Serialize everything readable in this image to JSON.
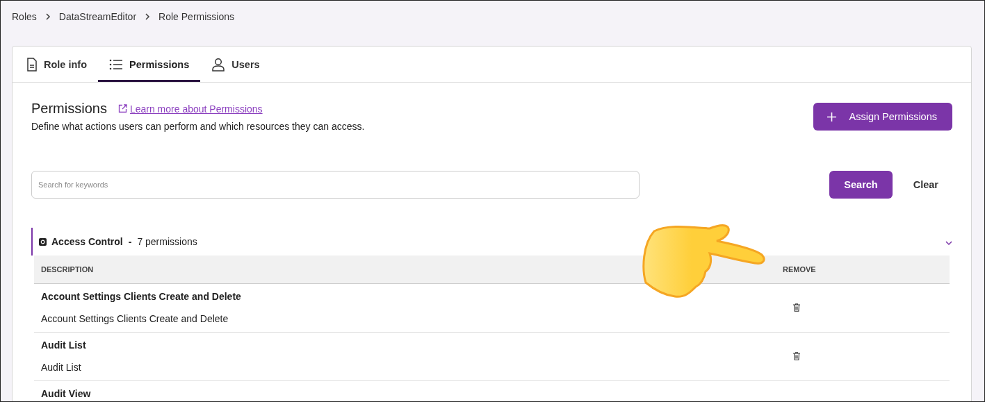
{
  "breadcrumb": [
    "Roles",
    "DataStreamEditor",
    "Role Permissions"
  ],
  "tabs": [
    {
      "label": "Role info",
      "selected": false
    },
    {
      "label": "Permissions",
      "selected": true
    },
    {
      "label": "Users",
      "selected": false
    }
  ],
  "header": {
    "title": "Permissions",
    "link": "Learn more about Permissions",
    "description": "Define what actions users can perform and which resources they can access.",
    "assign_button": "Assign Permissions"
  },
  "search": {
    "placeholder": "Search for keywords",
    "search_button": "Search",
    "clear_button": "Clear"
  },
  "group": {
    "name": "Access Control",
    "separator": "-",
    "count": "7 permissions",
    "expanded": true,
    "columns": [
      "DESCRIPTION",
      "REMOVE"
    ],
    "rows": [
      {
        "title": "Account Settings Clients Create and Delete",
        "description": "Account Settings Clients Create and Delete"
      },
      {
        "title": "Audit List",
        "description": "Audit List"
      },
      {
        "title": "Audit View"
      }
    ]
  },
  "pointer": {
    "kind": "hand"
  }
}
